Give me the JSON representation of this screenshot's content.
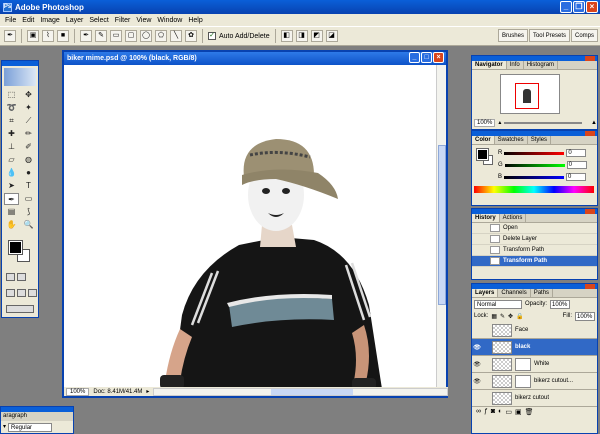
{
  "app": {
    "title": "Adobe Photoshop"
  },
  "menu": [
    "File",
    "Edit",
    "Image",
    "Layer",
    "Select",
    "Filter",
    "View",
    "Window",
    "Help"
  ],
  "options_bar": {
    "auto_add_delete_label": "Auto Add/Delete",
    "auto_add_delete_checked": true
  },
  "palette_well": [
    "Brushes",
    "Tool Presets",
    "Comps"
  ],
  "document": {
    "title": "biker mime.psd @ 100% (black, RGB/8)",
    "zoom": "100%",
    "doc_info": "Doc: 8.41M/41.4M"
  },
  "navigator": {
    "tabs": [
      "Navigator",
      "Info",
      "Histogram"
    ],
    "active_tab": "Navigator",
    "zoom": "100%"
  },
  "color": {
    "tabs": [
      "Color",
      "Swatches",
      "Styles"
    ],
    "active_tab": "Color",
    "channels": [
      {
        "label": "R",
        "value": "0"
      },
      {
        "label": "G",
        "value": "0"
      },
      {
        "label": "B",
        "value": "0"
      }
    ]
  },
  "history": {
    "tabs": [
      "History",
      "Actions"
    ],
    "active_tab": "History",
    "items": [
      {
        "label": "Open",
        "selected": false
      },
      {
        "label": "Delete Layer",
        "selected": false
      },
      {
        "label": "Transform Path",
        "selected": false
      },
      {
        "label": "Transform Path",
        "selected": true
      }
    ]
  },
  "layers": {
    "tabs": [
      "Layers",
      "Channels",
      "Paths"
    ],
    "active_tab": "Layers",
    "blend_mode": "Normal",
    "opacity_label": "Opacity:",
    "opacity": "100%",
    "lock_label": "Lock:",
    "fill_label": "Fill:",
    "fill": "100%",
    "items": [
      {
        "name": "Face",
        "visible": false,
        "selected": false,
        "has_mask": false
      },
      {
        "name": "black",
        "visible": true,
        "selected": true,
        "has_mask": false
      },
      {
        "name": "White",
        "visible": true,
        "selected": false,
        "has_mask": true
      },
      {
        "name": "bikerz cutout...",
        "visible": true,
        "selected": false,
        "has_mask": true
      },
      {
        "name": "bikerz cutout",
        "visible": false,
        "selected": false,
        "has_mask": false
      }
    ]
  },
  "paragraph": {
    "tab": "aragraph",
    "font_style": "Regular"
  },
  "colors": {
    "title_blue": "#0a5fd8",
    "selection": "#3169c6",
    "chrome": "#ece9d8"
  }
}
